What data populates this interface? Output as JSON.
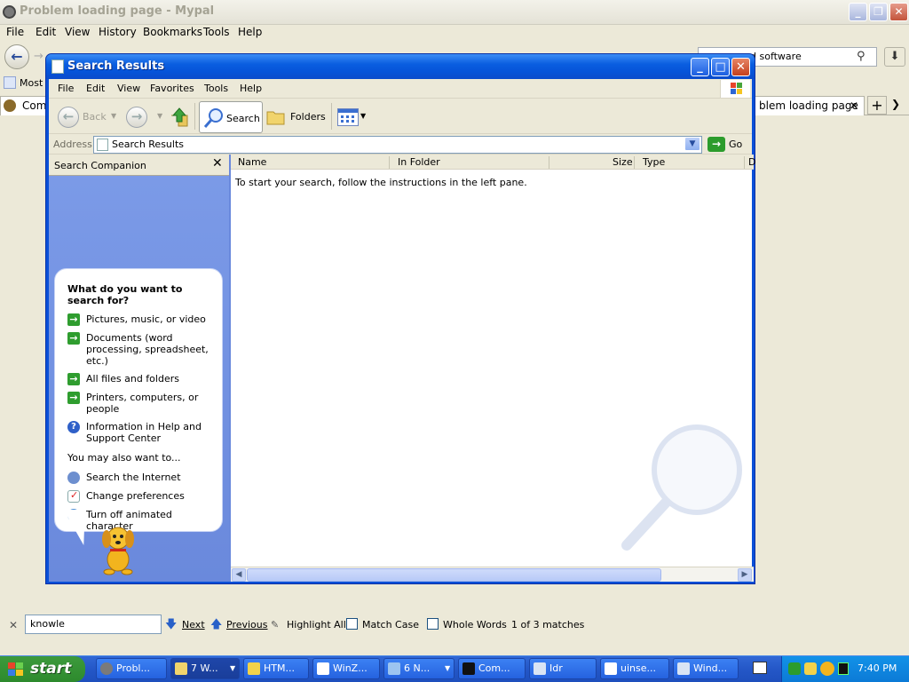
{
  "browser": {
    "title": "Problem loading page - Mypal",
    "menu": [
      "File",
      "Edit",
      "View",
      "History",
      "Bookmarks",
      "Tools",
      "Help"
    ],
    "search_value": "d software",
    "bookmark_label": "Most V",
    "tab_left": "Compu",
    "tab_right": "blem loading page"
  },
  "window": {
    "title": "Search Results",
    "menu": [
      "File",
      "Edit",
      "View",
      "Favorites",
      "Tools",
      "Help"
    ],
    "toolbar": {
      "back": "Back",
      "search": "Search",
      "folders": "Folders"
    },
    "address": {
      "label": "Address",
      "value": "Search Results",
      "go": "Go"
    },
    "companion": {
      "title": "Search Companion",
      "heading": "What do you want to search for?",
      "options": [
        "Pictures, music, or video",
        "Documents (word processing, spreadsheet, etc.)",
        "All files and folders",
        "Printers, computers, or people",
        "Information in Help and Support Center"
      ],
      "also_label": "You may also want to...",
      "also_options": [
        "Search the Internet",
        "Change preferences",
        "Turn off animated character"
      ]
    },
    "results": {
      "columns": [
        "Name",
        "In Folder",
        "Size",
        "Type",
        "D"
      ],
      "message": "To start your search, follow the instructions in the left pane."
    }
  },
  "findbar": {
    "query": "knowle",
    "next": "Next",
    "previous": "Previous",
    "highlight": "Highlight All",
    "match_case": "Match Case",
    "whole_words": "Whole Words",
    "status": "1 of 3 matches"
  },
  "taskbar": {
    "start": "start",
    "tasks": [
      "Probl...",
      "7 W...",
      "HTM...",
      "WinZ...",
      "6 N...",
      "Com...",
      "Idr",
      "uinse...",
      "Wind..."
    ],
    "clock": "7:40 PM"
  }
}
